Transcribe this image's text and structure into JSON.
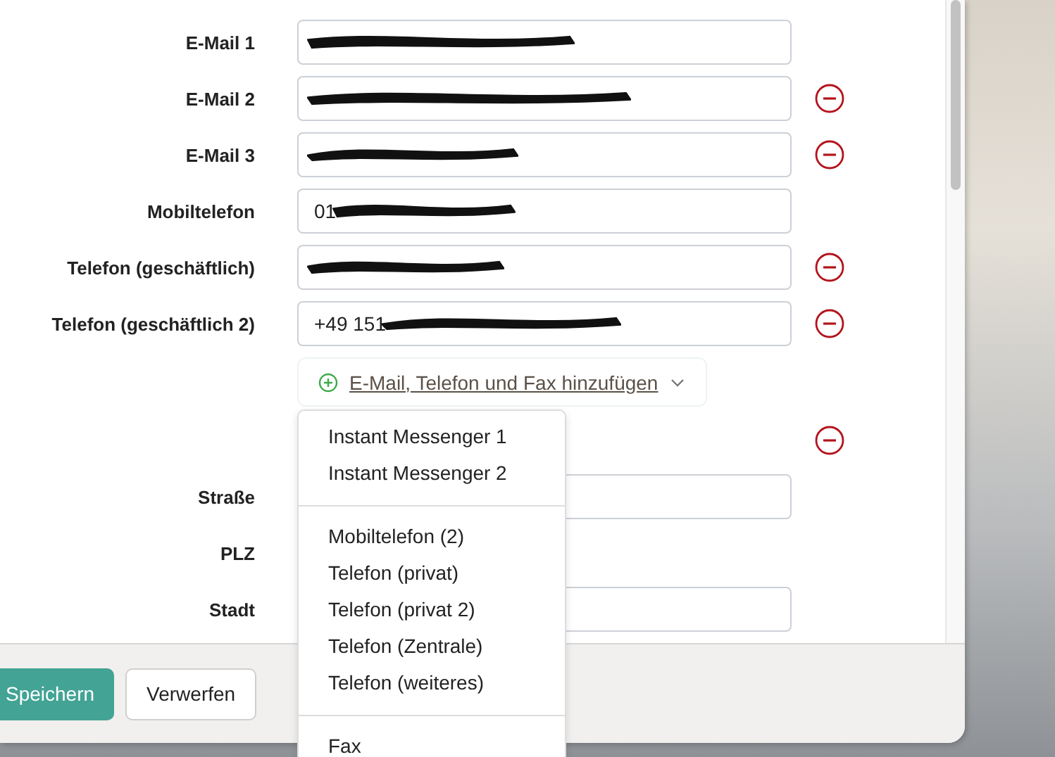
{
  "form": {
    "rows": [
      {
        "kind": "field",
        "label": "E-Mail 1",
        "value": "",
        "redacted": true,
        "removable": false
      },
      {
        "kind": "field",
        "label": "E-Mail 2",
        "value": "",
        "redacted": true,
        "removable": true
      },
      {
        "kind": "field",
        "label": "E-Mail 3",
        "value": "",
        "redacted": true,
        "removable": true
      },
      {
        "kind": "field",
        "label": "Mobiltelefon",
        "value": "01",
        "redacted": true,
        "removable": false
      },
      {
        "kind": "field",
        "label": "Telefon (geschäftlich)",
        "value": "",
        "redacted": true,
        "removable": true
      },
      {
        "kind": "field",
        "label": "Telefon (geschäftlich 2)",
        "value": "+49 151",
        "redacted": true,
        "removable": true
      }
    ],
    "add_button": {
      "label": "E-Mail, Telefon und Fax hinzufügen",
      "expanded": true
    },
    "address_rows": [
      {
        "kind": "remove_only",
        "removable": true
      },
      {
        "kind": "field",
        "label": "Straße",
        "value": "",
        "removable": false
      },
      {
        "kind": "label_only",
        "label": "PLZ"
      },
      {
        "kind": "field",
        "label": "Stadt",
        "value": "",
        "removable": false
      }
    ]
  },
  "dropdown": {
    "groups": [
      [
        "Instant Messenger 1",
        "Instant Messenger 2"
      ],
      [
        "Mobiltelefon (2)",
        "Telefon (privat)",
        "Telefon (privat 2)",
        "Telefon (Zentrale)",
        "Telefon (weiteres)"
      ],
      [
        "Fax"
      ]
    ]
  },
  "footer": {
    "buttons": [
      {
        "label": "Speichern",
        "kind": "primary"
      },
      {
        "label": "Verwerfen",
        "kind": "secondary"
      }
    ]
  }
}
